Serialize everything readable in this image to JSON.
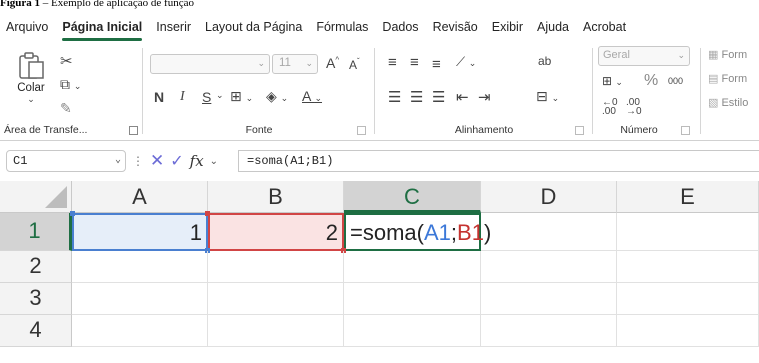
{
  "caption": {
    "bold": "Figura 1",
    "rest": " – Exemplo de aplicação de função"
  },
  "menu": [
    "Arquivo",
    "Página Inicial",
    "Inserir",
    "Layout da Página",
    "Fórmulas",
    "Dados",
    "Revisão",
    "Exibir",
    "Ajuda",
    "Acrobat"
  ],
  "ribbon": {
    "clipboard": {
      "paste_label": "Colar",
      "group_label": "Área de Transfe..."
    },
    "font": {
      "size": "11",
      "bold": "N",
      "italic": "I",
      "underline": "S",
      "group_label": "Fonte"
    },
    "alignment": {
      "group_label": "Alinhamento"
    },
    "number": {
      "format": "Geral",
      "percent": "%",
      "thousands": "000",
      "group_label": "Número"
    },
    "styles": {
      "items": [
        "Form",
        "Form",
        "Estilo"
      ]
    }
  },
  "formula_bar": {
    "name_box": "C1",
    "formula": "=soma(A1;B1)",
    "fx": "fx"
  },
  "grid": {
    "columns": [
      "A",
      "B",
      "C",
      "D",
      "E"
    ],
    "rows": [
      "1",
      "2",
      "3",
      "4"
    ],
    "cells": {
      "A1": "1",
      "B1": "2"
    },
    "editing": {
      "prefix": "=soma(",
      "ref1": "A1",
      "sep": ";",
      "ref2": "B1",
      "suffix": ")"
    }
  },
  "colors": {
    "accent": "#1e6e43",
    "ref_blue": "#3c78d8",
    "ref_red": "#c5322f"
  }
}
